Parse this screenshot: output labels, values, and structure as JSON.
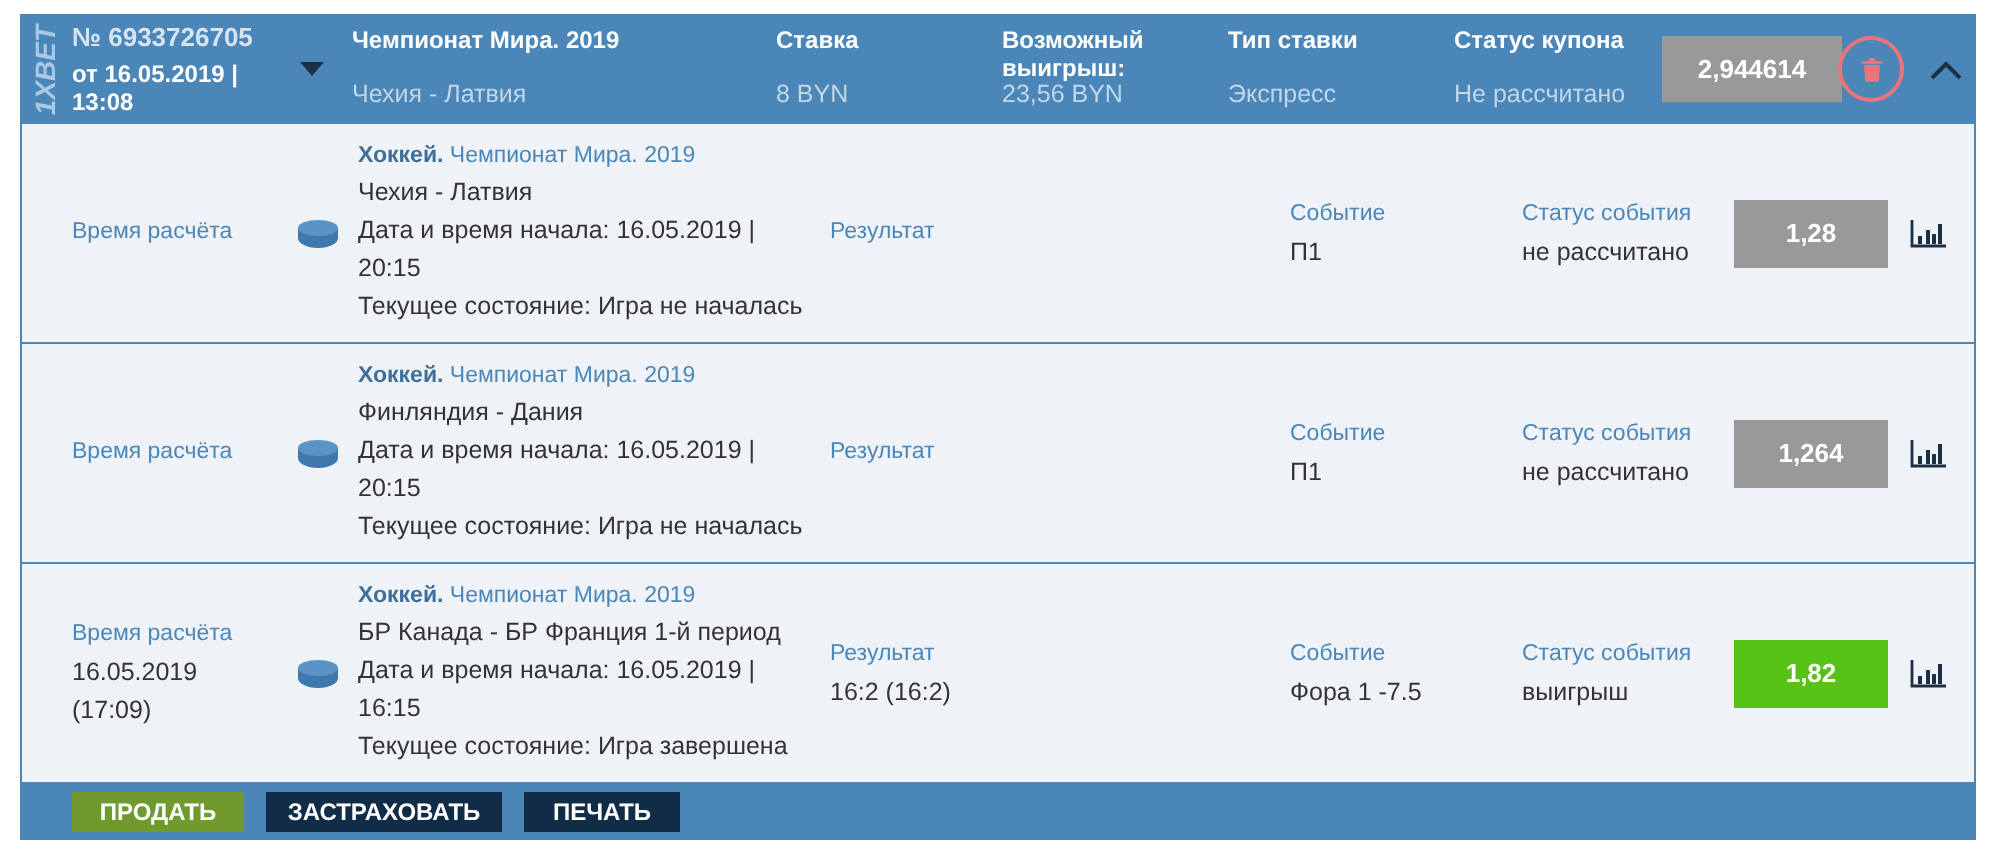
{
  "coupon": {
    "logo": "1XBET",
    "number": "№ 6933726705",
    "date": "от 16.05.2019 | 13:08",
    "championship": "Чемпионат Мира. 2019",
    "match": "Чехия - Латвия",
    "stake_label": "Ставка",
    "stake": "8 BYN",
    "win_label": "Возможный выигрыш:",
    "win": "23,56 BYN",
    "type_label": "Тип ставки",
    "type": "Экспресс",
    "status_label": "Статус купона",
    "status": "Не рассчитано",
    "odds": "2,944614",
    "expanded": true
  },
  "events": [
    {
      "time_label": "Время расчёта",
      "sport": "Хоккей.",
      "league": "Чемпионат Мира. 2019",
      "teams": "Чехия - Латвия",
      "start": "Дата и время начала: 16.05.2019 | 20:15",
      "state": "Текущее состояние: Игра не началась",
      "result_label": "Результат",
      "event_label": "Событие",
      "event": "П1",
      "status_label": "Статус события",
      "status": "не рассчитано",
      "odds": "1,28",
      "won": false
    },
    {
      "time_label": "Время расчёта",
      "sport": "Хоккей.",
      "league": "Чемпионат Мира. 2019",
      "teams": "Финляндия - Дания",
      "start": "Дата и время начала: 16.05.2019 | 20:15",
      "state": "Текущее состояние: Игра не началась",
      "result_label": "Результат",
      "event_label": "Событие",
      "event": "П1",
      "status_label": "Статус события",
      "status": "не рассчитано",
      "odds": "1,264",
      "won": false
    },
    {
      "time_label": "Время расчёта",
      "time": "16.05.2019 (17:09)",
      "sport": "Хоккей.",
      "league": "Чемпионат Мира. 2019",
      "teams": "БР Канада - БР Франция 1-й период",
      "start": "Дата и время начала: 16.05.2019 | 16:15",
      "state": "Текущее состояние: Игра завершена",
      "result_label": "Результат",
      "result": "16:2 (16:2)",
      "event_label": "Событие",
      "event": "Фора 1 -7.5",
      "status_label": "Статус события",
      "status": "выигрыш",
      "odds": "1,82",
      "won": true
    }
  ],
  "buttons": [
    {
      "label": "ПРОДАТЬ",
      "kind": "primary"
    },
    {
      "label": "ЗАСТРАХОВАТЬ",
      "kind": "dark"
    },
    {
      "label": "ПЕЧАТЬ",
      "kind": "dark"
    }
  ]
}
